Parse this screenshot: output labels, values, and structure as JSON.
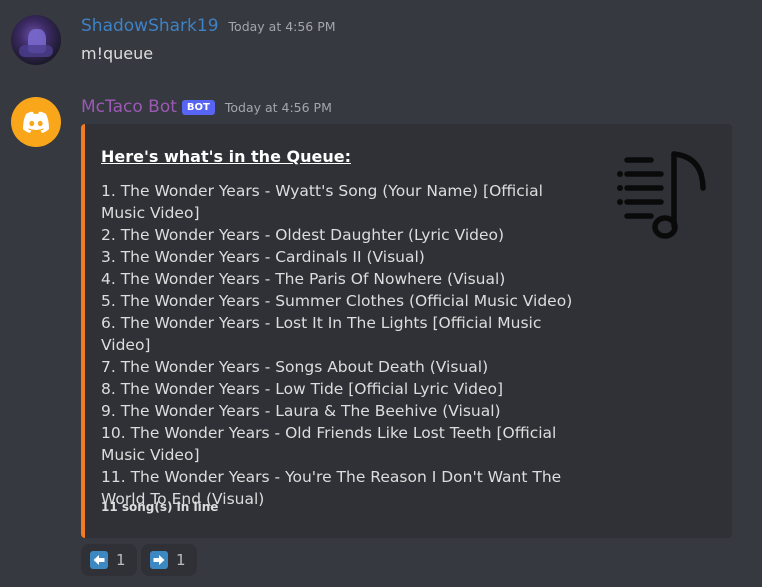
{
  "messages": [
    {
      "username": "ShadowShark19",
      "timestamp": "Today at 4:56 PM",
      "text": "m!queue"
    },
    {
      "username": "McTaco Bot",
      "bot_tag": "BOT",
      "timestamp": "Today at 4:56 PM"
    }
  ],
  "embed": {
    "title": "Here's what's in the Queue:",
    "items": [
      "1. The Wonder Years - Wyatt's Song (Your Name) [Official Music Video]",
      "2. The Wonder Years - Oldest Daughter (Lyric Video)",
      "3. The Wonder Years - Cardinals II (Visual)",
      "4. The Wonder Years - The Paris Of Nowhere (Visual)",
      "5. The Wonder Years - Summer Clothes (Official Music Video)",
      "6. The Wonder Years - Lost It In The Lights [Official Music Video]",
      "7. The Wonder Years - Songs About Death (Visual)",
      "8. The Wonder Years - Low Tide [Official Lyric Video]",
      "9. The Wonder Years - Laura & The Beehive (Visual)",
      "10. The Wonder Years - Old Friends Like Lost Teeth [Official Music Video]",
      "11. The Wonder Years - You're The Reason I Don't Want The World To End (Visual)"
    ],
    "footer": "11 song(s) in line",
    "thumbnail_icon": "music-queue-icon",
    "accent_color": "#f47b20"
  },
  "reactions": [
    {
      "emoji": "arrow-left-icon",
      "count": "1"
    },
    {
      "emoji": "arrow-right-icon",
      "count": "1"
    }
  ],
  "colors": {
    "background": "#36393f",
    "embed_background": "#2f3136",
    "user1_name": "#3e82c6",
    "user2_name": "#9b59b6",
    "bot_tag": "#5865f2",
    "bot_avatar": "#faa61a"
  }
}
